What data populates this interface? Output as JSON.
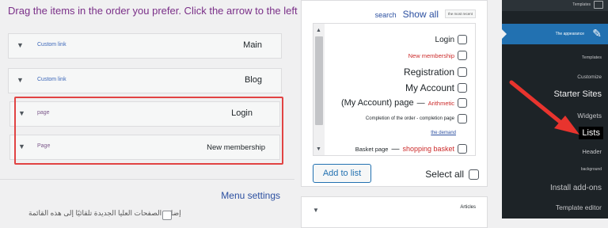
{
  "instruction": "Drag the items in the order you prefer. Click the arrow to the left",
  "menu_items": [
    {
      "type": "Custom link",
      "title": "Main"
    },
    {
      "type": "Custom link",
      "title": "Blog"
    },
    {
      "type": "page",
      "title": "Login"
    },
    {
      "type": "Page",
      "title": "New membership"
    }
  ],
  "menu_settings_label": "Menu settings",
  "bottom_rtl_text": "إضافة الصفحات العليا الجديدة تلقائيًا إلى هذه القائمة",
  "tabs": {
    "search": "search",
    "show_all": "Show all",
    "most_recent": "the most recent"
  },
  "list": {
    "items": [
      {
        "label": "Login"
      },
      {
        "label": "New membership"
      },
      {
        "label": "Registration"
      },
      {
        "label": "My Account"
      },
      {
        "label": "(My Account) page",
        "sep": "—",
        "extra": "Arithmetic"
      },
      {
        "label": "Completion of the order - completion page"
      },
      {
        "label": "Basket page",
        "sep": "—",
        "extra": "shopping basket"
      }
    ],
    "demand_link": "the demand"
  },
  "add_to_list": "Add to list",
  "select_all": "Select all",
  "articles_label": "Articles",
  "sidebar": {
    "top_label": "Templates",
    "active_label": "The appearance",
    "items": [
      {
        "label": "Templates"
      },
      {
        "label": "Customize"
      },
      {
        "label": "Starter Sites"
      },
      {
        "label": "Widgets"
      },
      {
        "label": "Lists"
      },
      {
        "label": "Header"
      },
      {
        "label": "background"
      },
      {
        "label": "Install add-ons"
      },
      {
        "label": "Template editor"
      }
    ]
  },
  "colors": {
    "accent": "#2271b1",
    "highlight": "#e14343",
    "sidebar_bg": "#1d2327"
  }
}
